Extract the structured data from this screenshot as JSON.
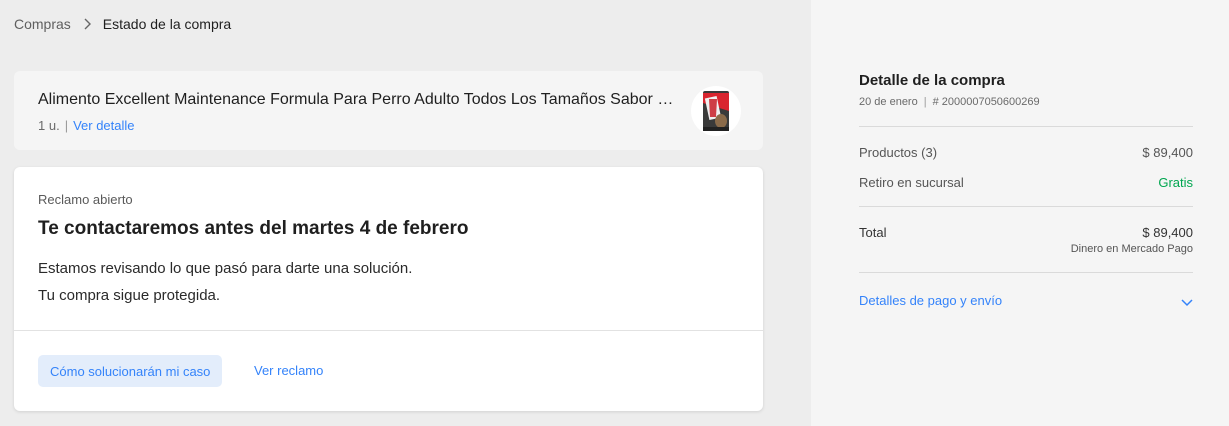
{
  "breadcrumb": {
    "parent": "Compras",
    "current": "Estado de la compra"
  },
  "product": {
    "title": "Alimento Excellent Maintenance Formula Para Perro Adulto Todos Los Tamaños Sabor Mi...",
    "quantity": "1 u.",
    "separator": "|",
    "detail_link": "Ver detalle",
    "thumbnail_icon": "dog-food-bag-image"
  },
  "claim": {
    "status": "Reclamo abierto",
    "heading": "Te contactaremos antes del martes 4 de febrero",
    "line1": "Estamos revisando lo que pasó para darte una solución.",
    "line2": "Tu compra sigue protegida.",
    "primary_button": "Cómo solucionarán mi caso",
    "secondary_link": "Ver reclamo"
  },
  "summary": {
    "title": "Detalle de la compra",
    "date": "20 de enero",
    "separator": "|",
    "order_number": "# 2000007050600269",
    "products_label": "Productos (3)",
    "products_value": "$ 89,400",
    "pickup_label": "Retiro en sucursal",
    "pickup_value": "Gratis",
    "total_label": "Total",
    "total_value": "$ 89,400",
    "payment_method": "Dinero en Mercado Pago",
    "details_toggle": "Detalles de pago y envío"
  },
  "colors": {
    "accent": "#3483fa",
    "accent_soft": "#e3edfb",
    "success": "#00a650",
    "page_bg": "#ededed",
    "sidebar_bg": "#f5f5f5"
  }
}
